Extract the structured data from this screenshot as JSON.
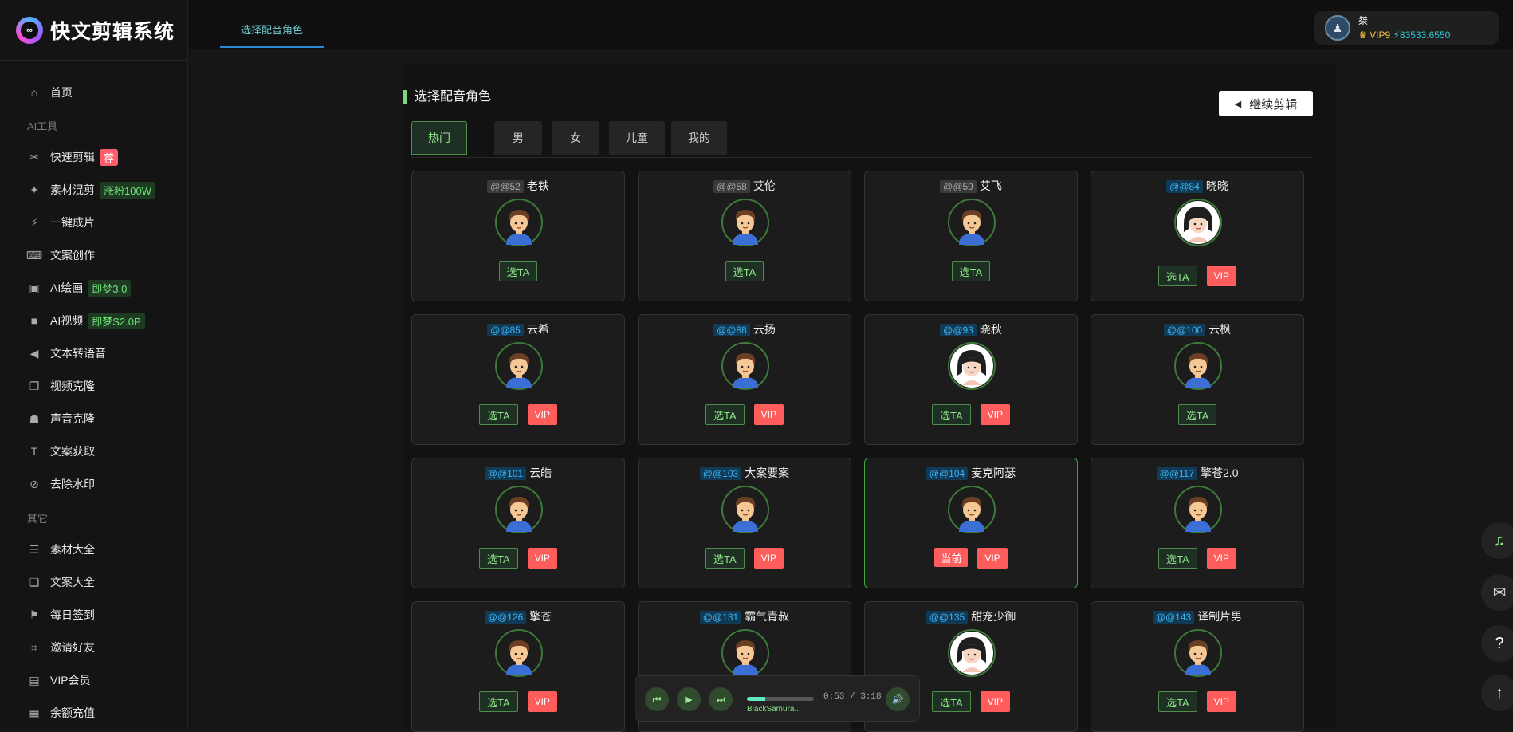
{
  "app": {
    "name": "快文剪辑系统",
    "logo_glyph": "∞"
  },
  "sidebar": {
    "home": "首页",
    "section_ai": "AI工具",
    "section_other": "其它",
    "items": [
      {
        "label": "快速剪辑",
        "badge": "荐",
        "badge_style": "red",
        "icon": "scissors-icon",
        "glyph": "✂"
      },
      {
        "label": "素材混剪",
        "badge": "涨粉100W",
        "badge_style": "green",
        "icon": "wand-icon",
        "glyph": "✦"
      },
      {
        "label": "一键成片",
        "badge": "",
        "icon": "bolt-icon",
        "glyph": "⚡"
      },
      {
        "label": "文案创作",
        "badge": "",
        "icon": "keyboard-icon",
        "glyph": "⌨"
      },
      {
        "label": "AI绘画",
        "badge": "即梦3.0",
        "badge_style": "green",
        "icon": "image-icon",
        "glyph": "▣"
      },
      {
        "label": "AI视频",
        "badge": "即梦S2.0P",
        "badge_style": "green",
        "icon": "video-icon",
        "glyph": "■"
      },
      {
        "label": "文本转语音",
        "badge": "",
        "icon": "speaker-icon",
        "glyph": "◀"
      },
      {
        "label": "视频克隆",
        "badge": "",
        "icon": "clone-icon",
        "glyph": "❐"
      },
      {
        "label": "声音克隆",
        "badge": "",
        "icon": "users-icon",
        "glyph": "☗"
      },
      {
        "label": "文案获取",
        "badge": "",
        "icon": "text-size-icon",
        "glyph": "T"
      },
      {
        "label": "去除水印",
        "badge": "",
        "icon": "no-watermark-icon",
        "glyph": "⊘"
      }
    ],
    "other_items": [
      {
        "label": "素材大全",
        "icon": "list-icon",
        "glyph": "☰"
      },
      {
        "label": "文案大全",
        "icon": "book-icon",
        "glyph": "❏"
      },
      {
        "label": "每日签到",
        "icon": "flag-icon",
        "glyph": "⚑"
      },
      {
        "label": "邀请好友",
        "icon": "invite-icon",
        "glyph": "⌗"
      },
      {
        "label": "VIP会员",
        "icon": "id-card-icon",
        "glyph": "▤"
      },
      {
        "label": "余额充值",
        "icon": "wallet-icon",
        "glyph": "▦"
      }
    ]
  },
  "topbar": {
    "tab_label": "选择配音角色"
  },
  "user": {
    "name": "桀",
    "vip": "VIP9",
    "balance": "83533.6550",
    "avatar_glyph": "♟"
  },
  "panel": {
    "title": "选择配音角色",
    "continue_label": "继续剪辑",
    "tabs": [
      "热门",
      "男",
      "女",
      "儿童",
      "我的"
    ],
    "active_tab": 0
  },
  "voices": [
    {
      "code": "@@52",
      "name": "老铁",
      "vip": false,
      "current": false,
      "gender": "male",
      "code_color": "gray"
    },
    {
      "code": "@@58",
      "name": "艾伦",
      "vip": false,
      "current": false,
      "gender": "male",
      "code_color": "gray"
    },
    {
      "code": "@@59",
      "name": "艾飞",
      "vip": false,
      "current": false,
      "gender": "male",
      "code_color": "gray"
    },
    {
      "code": "@@84",
      "name": "晓晓",
      "vip": true,
      "current": false,
      "gender": "female",
      "code_color": "blue"
    },
    {
      "code": "@@85",
      "name": "云希",
      "vip": true,
      "current": false,
      "gender": "male",
      "code_color": "blue"
    },
    {
      "code": "@@88",
      "name": "云扬",
      "vip": true,
      "current": false,
      "gender": "male",
      "code_color": "blue"
    },
    {
      "code": "@@93",
      "name": "晓秋",
      "vip": true,
      "current": false,
      "gender": "female",
      "code_color": "blue"
    },
    {
      "code": "@@100",
      "name": "云枫",
      "vip": false,
      "current": false,
      "gender": "male",
      "code_color": "blue"
    },
    {
      "code": "@@101",
      "name": "云皓",
      "vip": true,
      "current": false,
      "gender": "male",
      "code_color": "blue"
    },
    {
      "code": "@@103",
      "name": "大案要案",
      "vip": true,
      "current": false,
      "gender": "male",
      "code_color": "blue"
    },
    {
      "code": "@@104",
      "name": "麦克阿瑟",
      "vip": true,
      "current": true,
      "gender": "male",
      "code_color": "blue"
    },
    {
      "code": "@@117",
      "name": "擎苍2.0",
      "vip": true,
      "current": false,
      "gender": "male",
      "code_color": "blue"
    },
    {
      "code": "@@126",
      "name": "擎苍",
      "vip": true,
      "current": false,
      "gender": "male",
      "code_color": "blue"
    },
    {
      "code": "@@131",
      "name": "霸气青叔",
      "vip": true,
      "current": false,
      "gender": "male",
      "code_color": "blue"
    },
    {
      "code": "@@135",
      "name": "甜宠少御",
      "vip": true,
      "current": false,
      "gender": "female",
      "code_color": "blue"
    },
    {
      "code": "@@143",
      "name": "译制片男",
      "vip": true,
      "current": false,
      "gender": "male",
      "code_color": "blue"
    }
  ],
  "labels": {
    "select": "选TA",
    "vip": "VIP",
    "current": "当前"
  },
  "player": {
    "time": "0:53 / 3:18",
    "song": "BlackSamura...",
    "progress": 0.27
  },
  "fabs": [
    {
      "icon": "music-icon",
      "glyph": "♫",
      "color": "#8fe38a"
    },
    {
      "icon": "wechat-icon",
      "glyph": "✉",
      "color": "#ddd"
    },
    {
      "icon": "help-icon",
      "glyph": "?",
      "color": "#fff"
    },
    {
      "icon": "back-to-top-icon",
      "glyph": "↑",
      "color": "#fff"
    }
  ]
}
